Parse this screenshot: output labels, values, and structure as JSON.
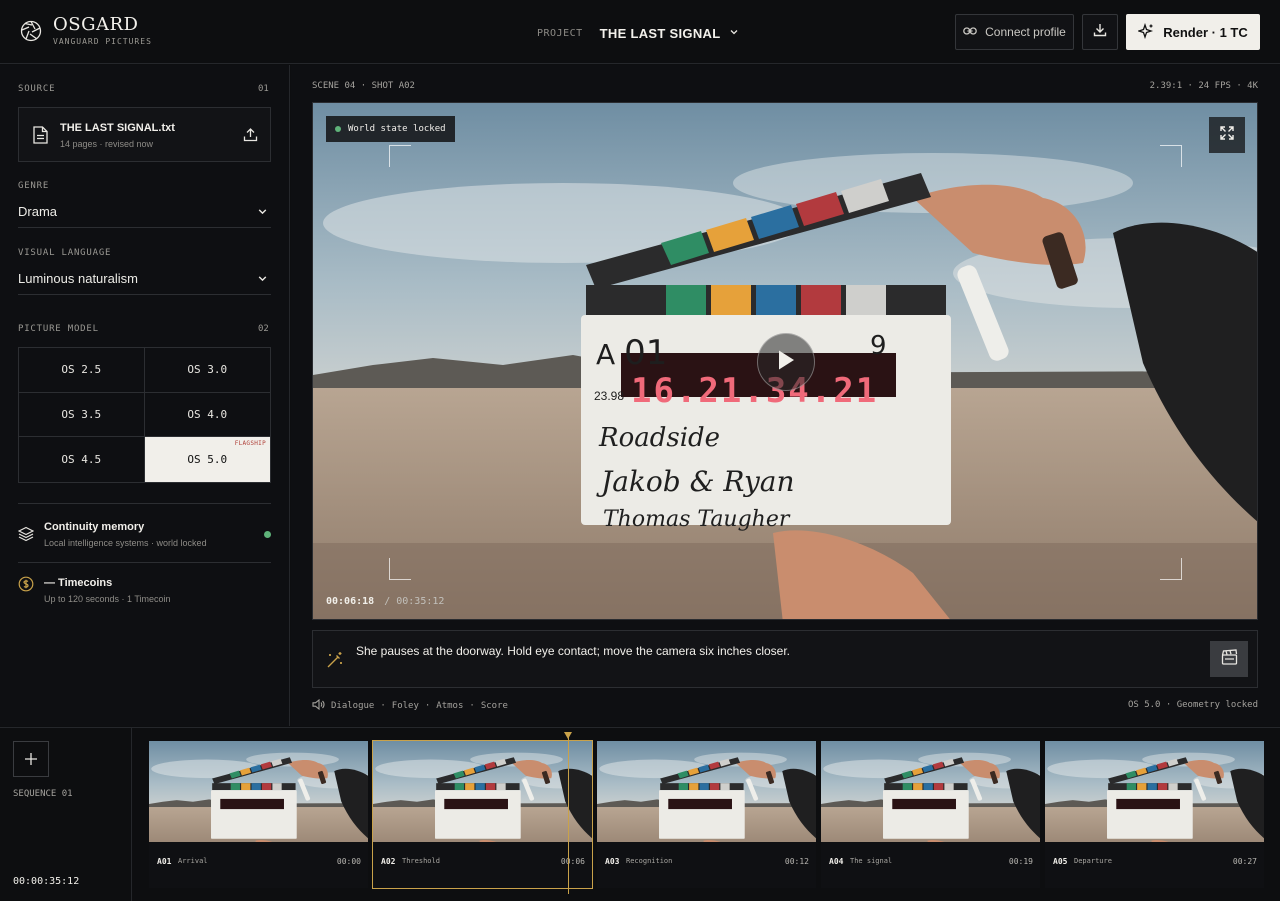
{
  "brand": {
    "name": "OSGARD",
    "sub": "VANGUARD PICTURES"
  },
  "project": {
    "label": "PROJECT",
    "title": "THE LAST SIGNAL"
  },
  "toolbar": {
    "connect_label": "Connect profile",
    "render_label": "Render · 1 TC"
  },
  "source": {
    "label": "SOURCE",
    "num": "01",
    "file_name": "THE LAST SIGNAL.txt",
    "file_meta": "14 pages · revised now"
  },
  "genre": {
    "label": "GENRE",
    "value": "Drama"
  },
  "visual_language": {
    "label": "VISUAL LANGUAGE",
    "value": "Luminous naturalism"
  },
  "picture_model": {
    "label": "PICTURE MODEL",
    "num": "02",
    "options": [
      "OS 2.5",
      "OS 3.0",
      "OS 3.5",
      "OS 4.0",
      "OS 4.5",
      "OS 5.0"
    ],
    "selected": "OS 5.0",
    "flag_label": "FLAGSHIP"
  },
  "continuity": {
    "title": "Continuity memory",
    "sub": "Local intelligence systems · world locked"
  },
  "timecoins": {
    "title": "— Timecoins",
    "sub": "Up to 120 seconds · 1 Timecoin"
  },
  "viewer": {
    "scene_shot": "SCENE 04 · SHOT A02",
    "specs": "2.39:1 · 24 FPS · 4K",
    "status_badge": "World state locked",
    "timecode_current": "00:06:18",
    "timecode_total": "/ 00:35:12",
    "clapper": {
      "roll": "A",
      "scene": "01",
      "take": "9",
      "fps": "23.98",
      "timecode": "16.21.34.21",
      "prod": "Roadside",
      "dir": "Jakob & Ryan",
      "cam": "Thomas Taugher"
    }
  },
  "prompt": {
    "text": "She pauses at the doorway. Hold eye contact; move the camera six inches closer."
  },
  "audio_tracks": [
    "Dialogue",
    "Foley",
    "Atmos",
    "Score"
  ],
  "model_status": "OS 5.0 · Geometry locked",
  "sequence": {
    "label": "SEQUENCE 01",
    "total_time": "00:00:35:12",
    "clips": [
      {
        "id": "A01",
        "name": "Arrival",
        "time": "00:00"
      },
      {
        "id": "A02",
        "name": "Threshold",
        "time": "00:06"
      },
      {
        "id": "A03",
        "name": "Recognition",
        "time": "00:12"
      },
      {
        "id": "A04",
        "name": "The signal",
        "time": "00:19"
      },
      {
        "id": "A05",
        "name": "Departure",
        "time": "00:27"
      }
    ],
    "selected_clip": "A02"
  },
  "colors": {
    "accent": "#c9a24a",
    "status_green": "#5fb37a",
    "flagship_red": "#b0413a"
  }
}
